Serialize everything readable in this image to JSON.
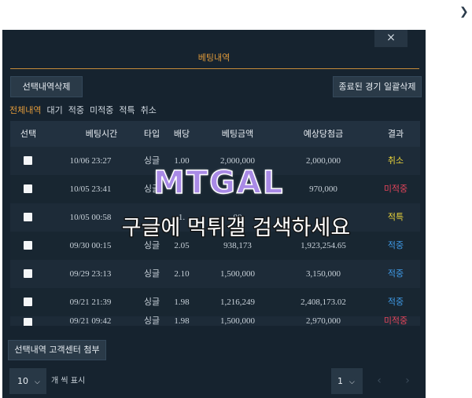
{
  "modal": {
    "close_label": "×",
    "title": "베팅내역",
    "delete_selected_label": "선택내역삭제",
    "delete_finished_label": "종료된 경기 일괄삭제",
    "filters": [
      "전체내역",
      "대기",
      "적중",
      "미적중",
      "적특",
      "취소"
    ],
    "active_filter": "전체내역",
    "columns": [
      "선택",
      "베팅시간",
      "타입",
      "배당",
      "베팅금액",
      "예상당첨금",
      "결과"
    ],
    "rows": [
      {
        "time": "10/06 23:27",
        "type": "싱글",
        "odds": "1.00",
        "amount": "2,000,000",
        "expected": "2,000,000",
        "result": "취소",
        "result_color": "#e8d23a"
      },
      {
        "time": "10/05 23:41",
        "type": "싱글",
        "odds": "",
        "amount": "",
        "expected": "970,000",
        "result": "미적중",
        "result_color": "#e2445a"
      },
      {
        "time": "10/05 00:58",
        "type": "",
        "odds": "1.",
        "amount": "00",
        "expected": "",
        "result": "적특",
        "result_color": "#e8d23a"
      },
      {
        "time": "09/30 00:15",
        "type": "싱글",
        "odds": "2.05",
        "amount": "938,173",
        "expected": "1,923,254.65",
        "result": "적중",
        "result_color": "#3f9ae6"
      },
      {
        "time": "09/29 23:13",
        "type": "싱글",
        "odds": "2.10",
        "amount": "1,500,000",
        "expected": "3,150,000",
        "result": "적중",
        "result_color": "#3f9ae6"
      },
      {
        "time": "09/21 21:39",
        "type": "싱글",
        "odds": "1.98",
        "amount": "1,216,249",
        "expected": "2,408,173.02",
        "result": "적중",
        "result_color": "#3f9ae6"
      },
      {
        "time": "09/21 09:42",
        "type": "싱글",
        "odds": "1.98",
        "amount": "1,500,000",
        "expected": "2,970,000",
        "result": "미적중",
        "result_color": "#e2445a"
      }
    ],
    "attach_label": "선택내역 고객센터 첨부",
    "per_page_value": "10",
    "per_page_label": "개 씩 표시",
    "page_value": "1",
    "prev_icon": "chevron-left-icon",
    "next_icon": "chevron-right-icon"
  },
  "watermark": {
    "logo": "MTGAL",
    "text": "구글에 먹튀갤 검색하세요"
  }
}
